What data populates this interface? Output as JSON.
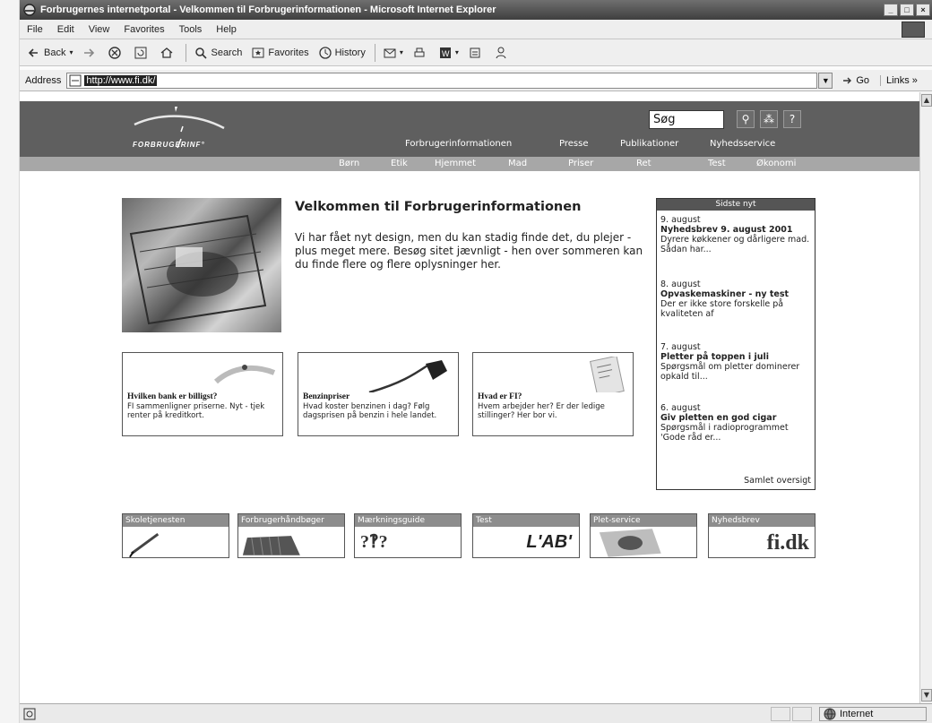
{
  "window": {
    "title": "Forbrugernes internetportal - Velkommen til Forbrugerinformationen - Microsoft Internet Explorer",
    "minimize": "_",
    "maximize": "□",
    "close": "×"
  },
  "menu": [
    "File",
    "Edit",
    "View",
    "Favorites",
    "Tools",
    "Help"
  ],
  "toolbar": {
    "back": "Back",
    "search": "Search",
    "favorites": "Favorites",
    "history": "History"
  },
  "address": {
    "label": "Address",
    "url": "http://www.fi.dk/",
    "go": "Go",
    "links": "Links »"
  },
  "site": {
    "logo": "FORBRUGERINF°",
    "search_value": "Søg",
    "main_nav": [
      "Forbrugerinformationen",
      "Presse",
      "Publikationer",
      "Nyhedsservice"
    ],
    "sub_nav": [
      "Børn",
      "Etik",
      "Hjemmet",
      "Mad",
      "Priser",
      "Ret",
      "Test",
      "Økonomi"
    ]
  },
  "welcome": {
    "title": "Velkommen til Forbrugerinformationen",
    "text": "Vi har fået nyt design, men du kan stadig finde det, du plejer - plus meget mere. Besøg sitet jævnligt - hen over sommeren kan du finde flere og flere oplysninger her."
  },
  "news": {
    "header": "Sidste nyt",
    "items": [
      {
        "date": "9. august",
        "title": "Nyhedsbrev 9. august 2001",
        "body": "Dyrere køkkener og dårligere mad. Sådan har..."
      },
      {
        "date": "8. august",
        "title": "Opvaskemaskiner - ny test",
        "body": "Der er ikke store forskelle på kvaliteten af"
      },
      {
        "date": "7. august",
        "title": "Pletter på toppen i juli",
        "body": "Spørgsmål om pletter dominerer opkald til..."
      },
      {
        "date": "6. august",
        "title": "Giv pletten en god cigar",
        "body": "Spørgsmål i radioprogrammet 'Gode råd er..."
      }
    ],
    "all": "Samlet oversigt"
  },
  "features": [
    {
      "title": "Hvilken bank er billigst?",
      "body": "FI sammenligner priserne. Nyt - tjek renter på kreditkort."
    },
    {
      "title": "Benzinpriser",
      "body": "Hvad koster benzinen i dag? Følg dagsprisen på benzin i hele landet."
    },
    {
      "title": "Hvad er FI?",
      "body": "Hvem arbejder her? Er der ledige stillinger? Her bor vi."
    }
  ],
  "banners": [
    {
      "label": "Skoletjenesten",
      "art": ""
    },
    {
      "label": "Forbrugerhåndbøger",
      "art": ""
    },
    {
      "label": "Mærkningsguide",
      "art": "?‽?"
    },
    {
      "label": "Test",
      "art": "L'AB'"
    },
    {
      "label": "Plet-service",
      "art": ""
    },
    {
      "label": "Nyhedsbrev",
      "art": "fi.dk"
    }
  ],
  "status": {
    "zone": "Internet"
  },
  "colors": {
    "header_bg": "#5f5f5f",
    "subnav_bg": "#a7a7a7",
    "news_header": "#555555"
  }
}
